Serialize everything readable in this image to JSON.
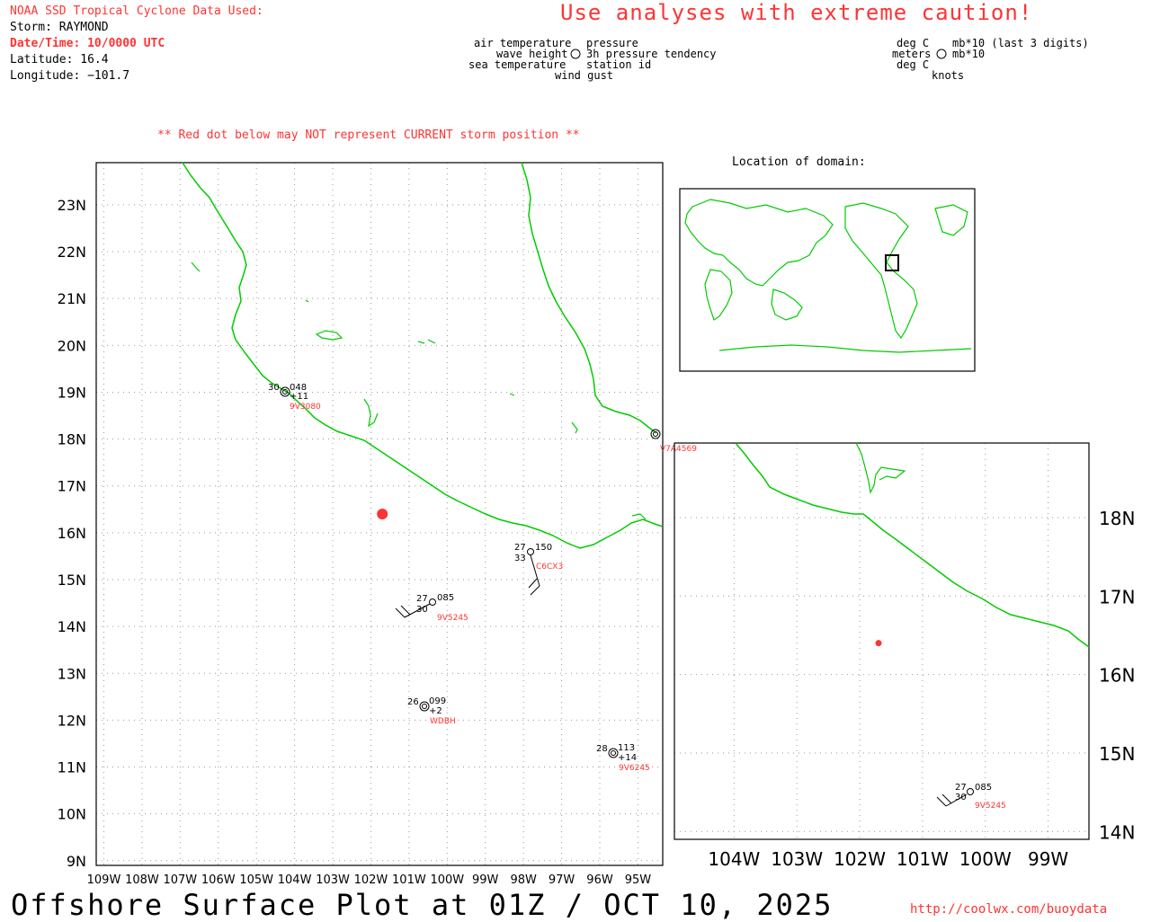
{
  "header": {
    "source": "NOAA SSD Tropical Cyclone Data Used:",
    "storm": "Storm: RAYMOND",
    "datetime": "Date/Time: 10/0000 UTC",
    "latitude": "Latitude: 16.4",
    "longitude": "Longitude: −101.7",
    "caution": "Use analyses with extreme caution!",
    "red_dot_note": "** Red dot below may NOT represent CURRENT storm position **"
  },
  "legend_left": {
    "line1_left": "air temperature",
    "line1_right": "pressure",
    "line2_left": "wave height",
    "line2_right": "3h pressure tendency",
    "line3_left": "sea temperature",
    "line3_right": "station id",
    "line4": "wind gust"
  },
  "legend_right": {
    "line1_left": "deg C",
    "line1_right": "mb*10 (last 3 digits)",
    "line2_left": "meters",
    "line2_right": "mb*10",
    "line3_left": "deg C",
    "line4": "knots"
  },
  "inset_title": "Location of domain:",
  "main_map": {
    "lat_labels": [
      "23N",
      "22N",
      "21N",
      "20N",
      "19N",
      "18N",
      "17N",
      "16N",
      "15N",
      "14N",
      "13N",
      "12N",
      "11N",
      "10N",
      "9N"
    ],
    "lon_labels": [
      "109W",
      "108W",
      "107W",
      "106W",
      "105W",
      "104W",
      "103W",
      "102W",
      "101W",
      "100W",
      "99W",
      "98W",
      "97W",
      "96W",
      "95W"
    ]
  },
  "zoom_map": {
    "lat_labels": [
      "18N",
      "17N",
      "16N",
      "15N",
      "14N"
    ],
    "lon_labels": [
      "104W",
      "103W",
      "102W",
      "101W",
      "100W",
      "99W"
    ]
  },
  "storm_position": {
    "lat": 16.4,
    "lon": -101.7
  },
  "stations": [
    {
      "id": "9V3080",
      "air_temp": "30",
      "pressure": "048",
      "tendency": "+11"
    },
    {
      "id": "V7A4569"
    },
    {
      "id": "C6CX3",
      "air_temp": "27",
      "pressure": "150",
      "sea_temp": "33"
    },
    {
      "id": "9V5245",
      "air_temp": "27",
      "pressure": "085",
      "sea_temp": "30"
    },
    {
      "id": "WDBH",
      "air_temp": "26",
      "pressure": "099",
      "tendency": "+2"
    },
    {
      "id": "9V6245",
      "air_temp": "28",
      "pressure": "113",
      "tendency": "+14"
    }
  ],
  "footer": {
    "title": "Offshore Surface Plot at 01Z / OCT 10, 2025",
    "url": "http://coolwx.com/buoydata"
  },
  "colors": {
    "coast": "#00cc00",
    "accent": "#ff3333",
    "frame": "#000000",
    "grid": "#999999"
  }
}
